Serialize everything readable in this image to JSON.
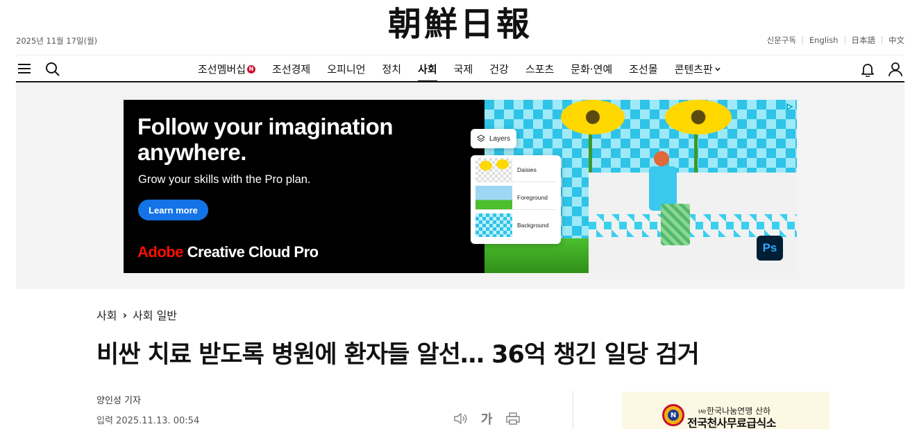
{
  "masthead": {
    "logo": "朝鮮日報",
    "date": "2025년 11월 17일(월)",
    "links": [
      "신문구독",
      "English",
      "日本語",
      "中文"
    ]
  },
  "gnb": {
    "items": [
      {
        "label": "조선멤버십",
        "badge": "N"
      },
      {
        "label": "조선경제"
      },
      {
        "label": "오피니언"
      },
      {
        "label": "정치"
      },
      {
        "label": "사회",
        "active": true
      },
      {
        "label": "국제"
      },
      {
        "label": "건강"
      },
      {
        "label": "스포츠"
      },
      {
        "label": "문화·연예"
      },
      {
        "label": "조선몰"
      },
      {
        "label": "콘텐츠판",
        "dropdown": true
      }
    ],
    "icons": [
      "menu-icon",
      "search-icon",
      "bell-icon",
      "user-icon"
    ]
  },
  "ad": {
    "headline": "Follow your imagination anywhere.",
    "subtext": "Grow your skills with the Pro plan.",
    "cta": "Learn more",
    "brand_red": "Adobe",
    "brand_white": " Creative Cloud Pro",
    "panel_tab": "Layers",
    "layers": [
      "Daisies",
      "Foreground",
      "Background"
    ],
    "app_badge": "Ps",
    "colors": {
      "cta": "#1473e6",
      "brand": "#fa0f00",
      "checker": "#2fc3e8"
    }
  },
  "article": {
    "breadcrumb": [
      "사회",
      "사회 일반"
    ],
    "title": "비싼 치료 받도록 병원에 환자들 알선… 36억 챙긴 일당 검거",
    "author": "양인성 기자",
    "published": "입력 2025.11.13. 00:54",
    "tools": {
      "listen": "speaker-icon",
      "font_size": "가",
      "print": "print-icon"
    }
  },
  "side_banner": {
    "org_small": "(사)",
    "org": "한국나눔연맹 산하",
    "title": "전국천사무료급식소"
  }
}
